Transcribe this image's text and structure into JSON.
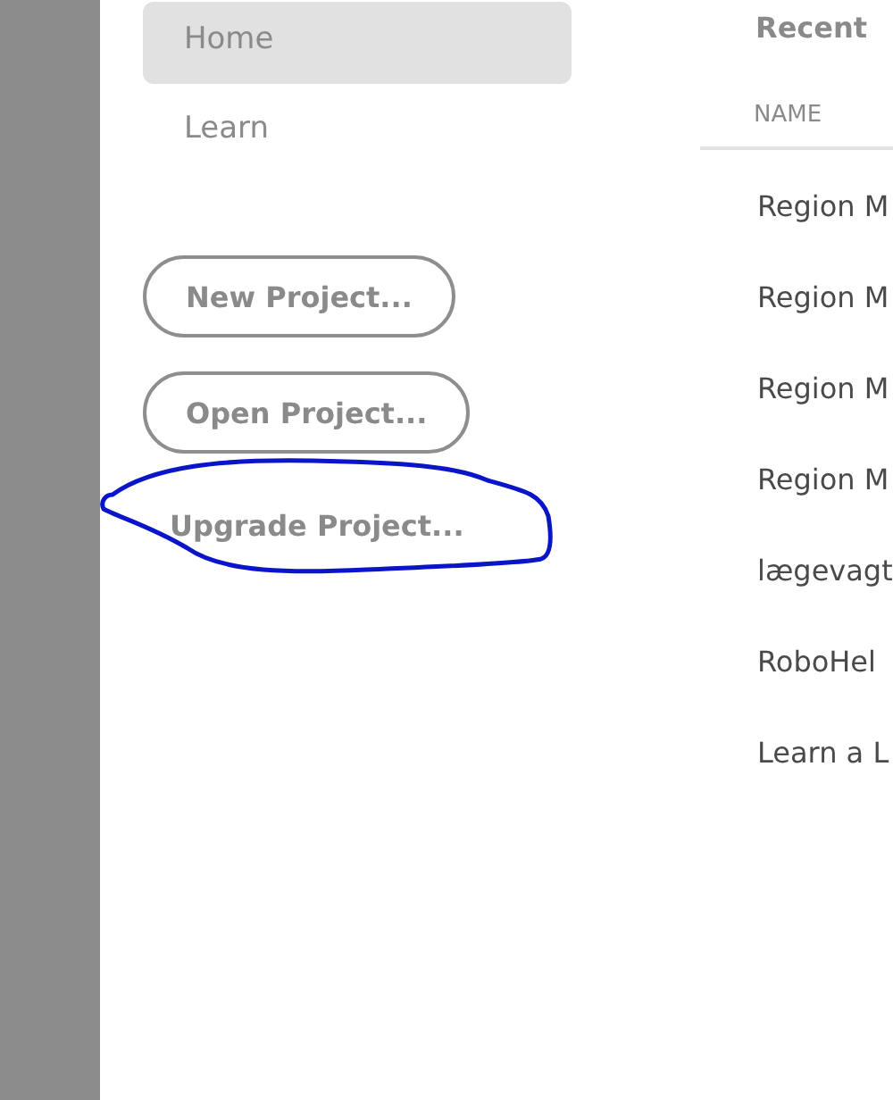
{
  "nav": [
    {
      "label": "Home",
      "selected": true
    },
    {
      "label": "Learn",
      "selected": false
    }
  ],
  "buttons": [
    {
      "label": "New Project...",
      "kind": "outline"
    },
    {
      "label": "Open Project...",
      "kind": "outline"
    },
    {
      "label": "Upgrade Project...",
      "kind": "quiet"
    }
  ],
  "recent": {
    "title": "Recent",
    "columns": [
      "NAME"
    ],
    "rows": [
      "Region M",
      "Region M",
      "Region M",
      "Region M",
      "lægevagt",
      "RoboHel",
      "Learn a L"
    ]
  },
  "annotation": {
    "kind": "ellipse",
    "color": "#0a14c8"
  }
}
